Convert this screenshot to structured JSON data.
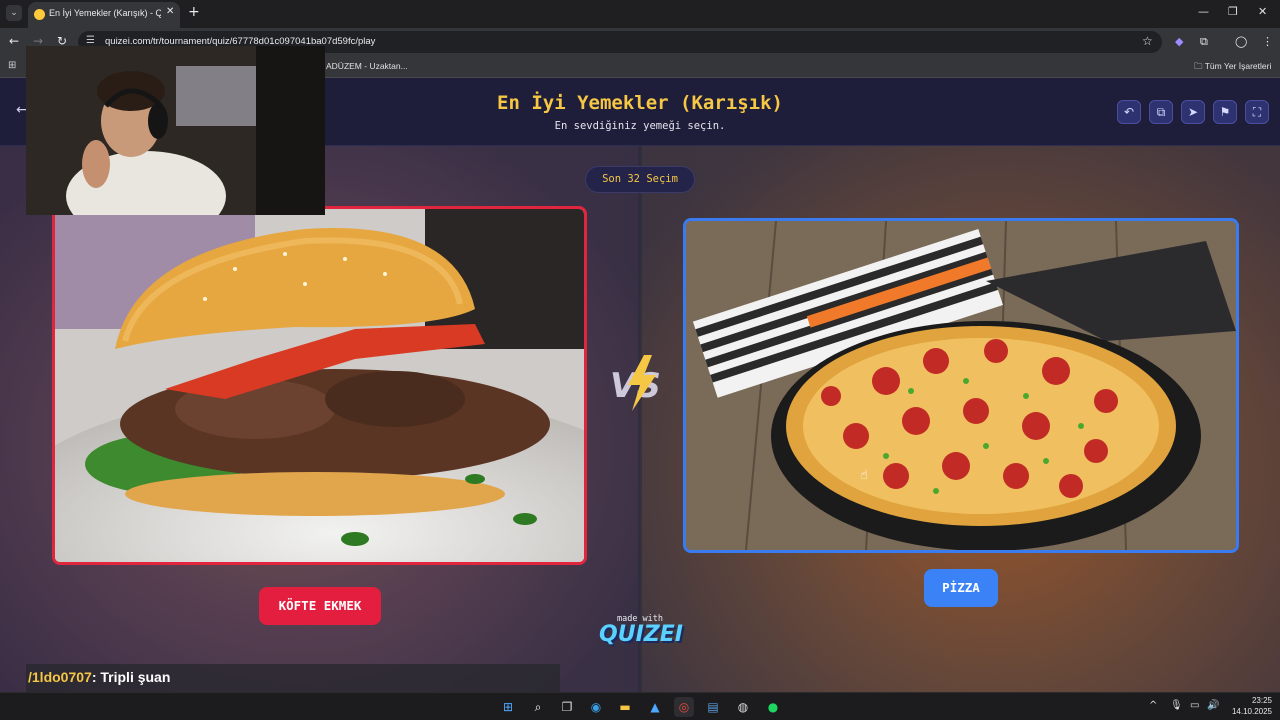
{
  "browser": {
    "tab_title": "En İyi Yemekler (Karışık) - Quize",
    "tab_close": "✕",
    "new_tab": "+",
    "url": "quizei.com/tr/tournament/quiz/67778d01c097041ba07d59fc/play",
    "bookmark_item": "ADÜZEM - Uzaktan...",
    "bookmark_all": "Tüm Yer İşaretleri",
    "icons": [
      "back-icon",
      "forward-icon",
      "reload-icon",
      "site-info-icon",
      "bookmark-star-icon",
      "extensions-icon",
      "profile-icon",
      "menu-icon"
    ]
  },
  "quiz": {
    "title": "En İyi Yemekler (Karışık)",
    "subtitle": "En sevdiğiniz yemeği seçin.",
    "round": "Son 32 Seçim",
    "left_choice": "KÖFTE EKMEK",
    "right_choice": "PİZZA",
    "vs": "VS",
    "made_with": "made with",
    "brand": "Quizei",
    "accent_left": "#e31e3f",
    "accent_right": "#3b82f6",
    "title_color": "#f6c744"
  },
  "chat": {
    "user": "/1ldo0707",
    "message": ": Tripli şuan"
  },
  "taskbar": {
    "time": "23:25",
    "date": "14.10.2025"
  }
}
